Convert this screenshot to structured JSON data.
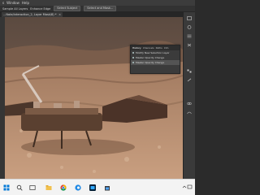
{
  "menubar": {
    "items": [
      "s",
      "Window",
      "Help"
    ]
  },
  "optionsbar": {
    "sample_all_layers": "Sample All Layers",
    "enhance_edge": "Enhance Edge",
    "select_subject": "Select Subject",
    "select_and_mask": "Select and Mask..."
  },
  "document_tab": {
    "title": "...Note/interaction_2, Layer Mask/8) *",
    "close": "×"
  },
  "history_panel": {
    "tabs": [
      "History",
      "Channels",
      "Paths",
      "Info"
    ],
    "items": [
      "Modify New Selection Layer",
      "Master Opacity Change",
      "Master Opacity Change"
    ]
  },
  "colors": {
    "app_dark": "#2b2b2b",
    "panel": "#3b3b3b",
    "selected_row": "#545454",
    "taskbar": "#f3f3f3",
    "sky": "#6e5a4c",
    "ground": "#b48a6c"
  },
  "icons": [
    "windows-start-icon",
    "search-icon",
    "task-view-icon",
    "file-explorer-icon",
    "chrome-icon",
    "edge-icon",
    "photoshop-icon",
    "store-icon"
  ]
}
